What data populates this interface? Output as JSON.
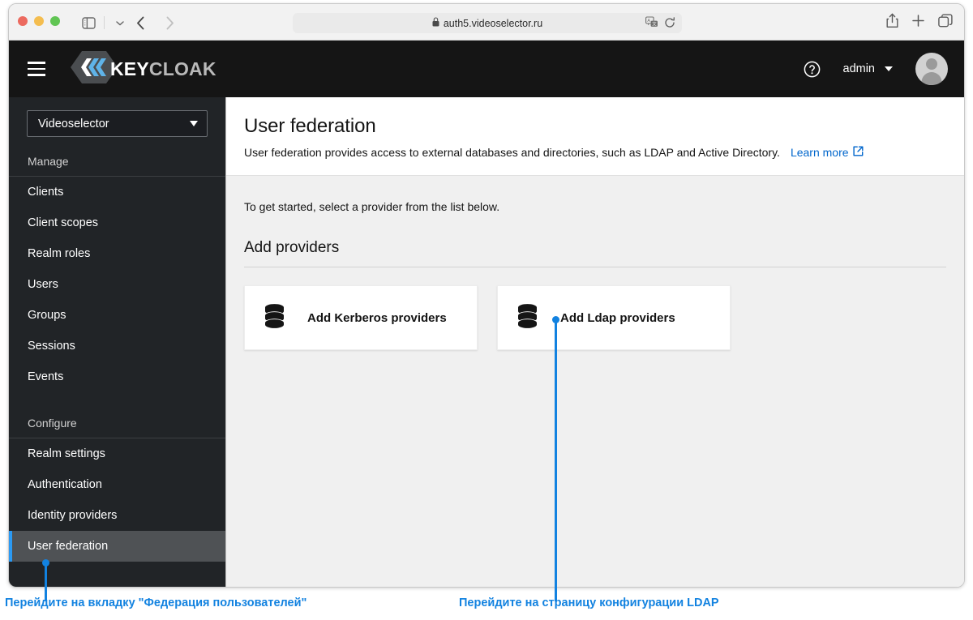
{
  "browser": {
    "url": "auth5.videoselector.ru",
    "lock_icon": "lock-icon",
    "translate_icon": "translate-icon",
    "reload_icon": "reload-icon",
    "sidebar_toggle_icon": "sidebar-toggle-icon",
    "chevron_down_icon": "chevron-down-icon",
    "back_icon": "back-arrow-icon",
    "forward_icon": "forward-arrow-icon",
    "share_icon": "share-icon",
    "new_tab_icon": "plus-icon",
    "tabs_icon": "tabs-overview-icon"
  },
  "masthead": {
    "menu_icon": "hamburger-menu-icon",
    "logo_mark": "keycloak-logo-icon",
    "logo_text_a": "KEY",
    "logo_text_b": "CLOAK",
    "help_icon": "help-circle-icon",
    "username": "admin",
    "caret_icon": "chevron-down-icon",
    "avatar_icon": "user-avatar-icon"
  },
  "sidebar": {
    "realm": "Videoselector",
    "realm_caret_icon": "chevron-down-icon",
    "sections": [
      {
        "heading": "Manage",
        "items": [
          {
            "label": "Clients",
            "active": false
          },
          {
            "label": "Client scopes",
            "active": false
          },
          {
            "label": "Realm roles",
            "active": false
          },
          {
            "label": "Users",
            "active": false
          },
          {
            "label": "Groups",
            "active": false
          },
          {
            "label": "Sessions",
            "active": false
          },
          {
            "label": "Events",
            "active": false
          }
        ]
      },
      {
        "heading": "Configure",
        "items": [
          {
            "label": "Realm settings",
            "active": false
          },
          {
            "label": "Authentication",
            "active": false
          },
          {
            "label": "Identity providers",
            "active": false
          },
          {
            "label": "User federation",
            "active": true
          }
        ]
      }
    ]
  },
  "main": {
    "title": "User federation",
    "subtitle": "User federation provides access to external databases and directories, such as LDAP and Active Directory.",
    "learn_more": "Learn more",
    "external_link_icon": "external-link-icon",
    "get_started": "To get started, select a provider from the list below.",
    "add_providers_title": "Add providers",
    "cards": [
      {
        "label": "Add Kerberos providers",
        "icon": "database-icon"
      },
      {
        "label": "Add Ldap providers",
        "icon": "database-icon"
      }
    ]
  },
  "annotations": {
    "color": "#1282e0",
    "items": [
      {
        "text": "Перейдите на вкладку \"Федерация пользователей\""
      },
      {
        "text": "Перейдите на страницу конфигурации LDAP"
      }
    ]
  }
}
